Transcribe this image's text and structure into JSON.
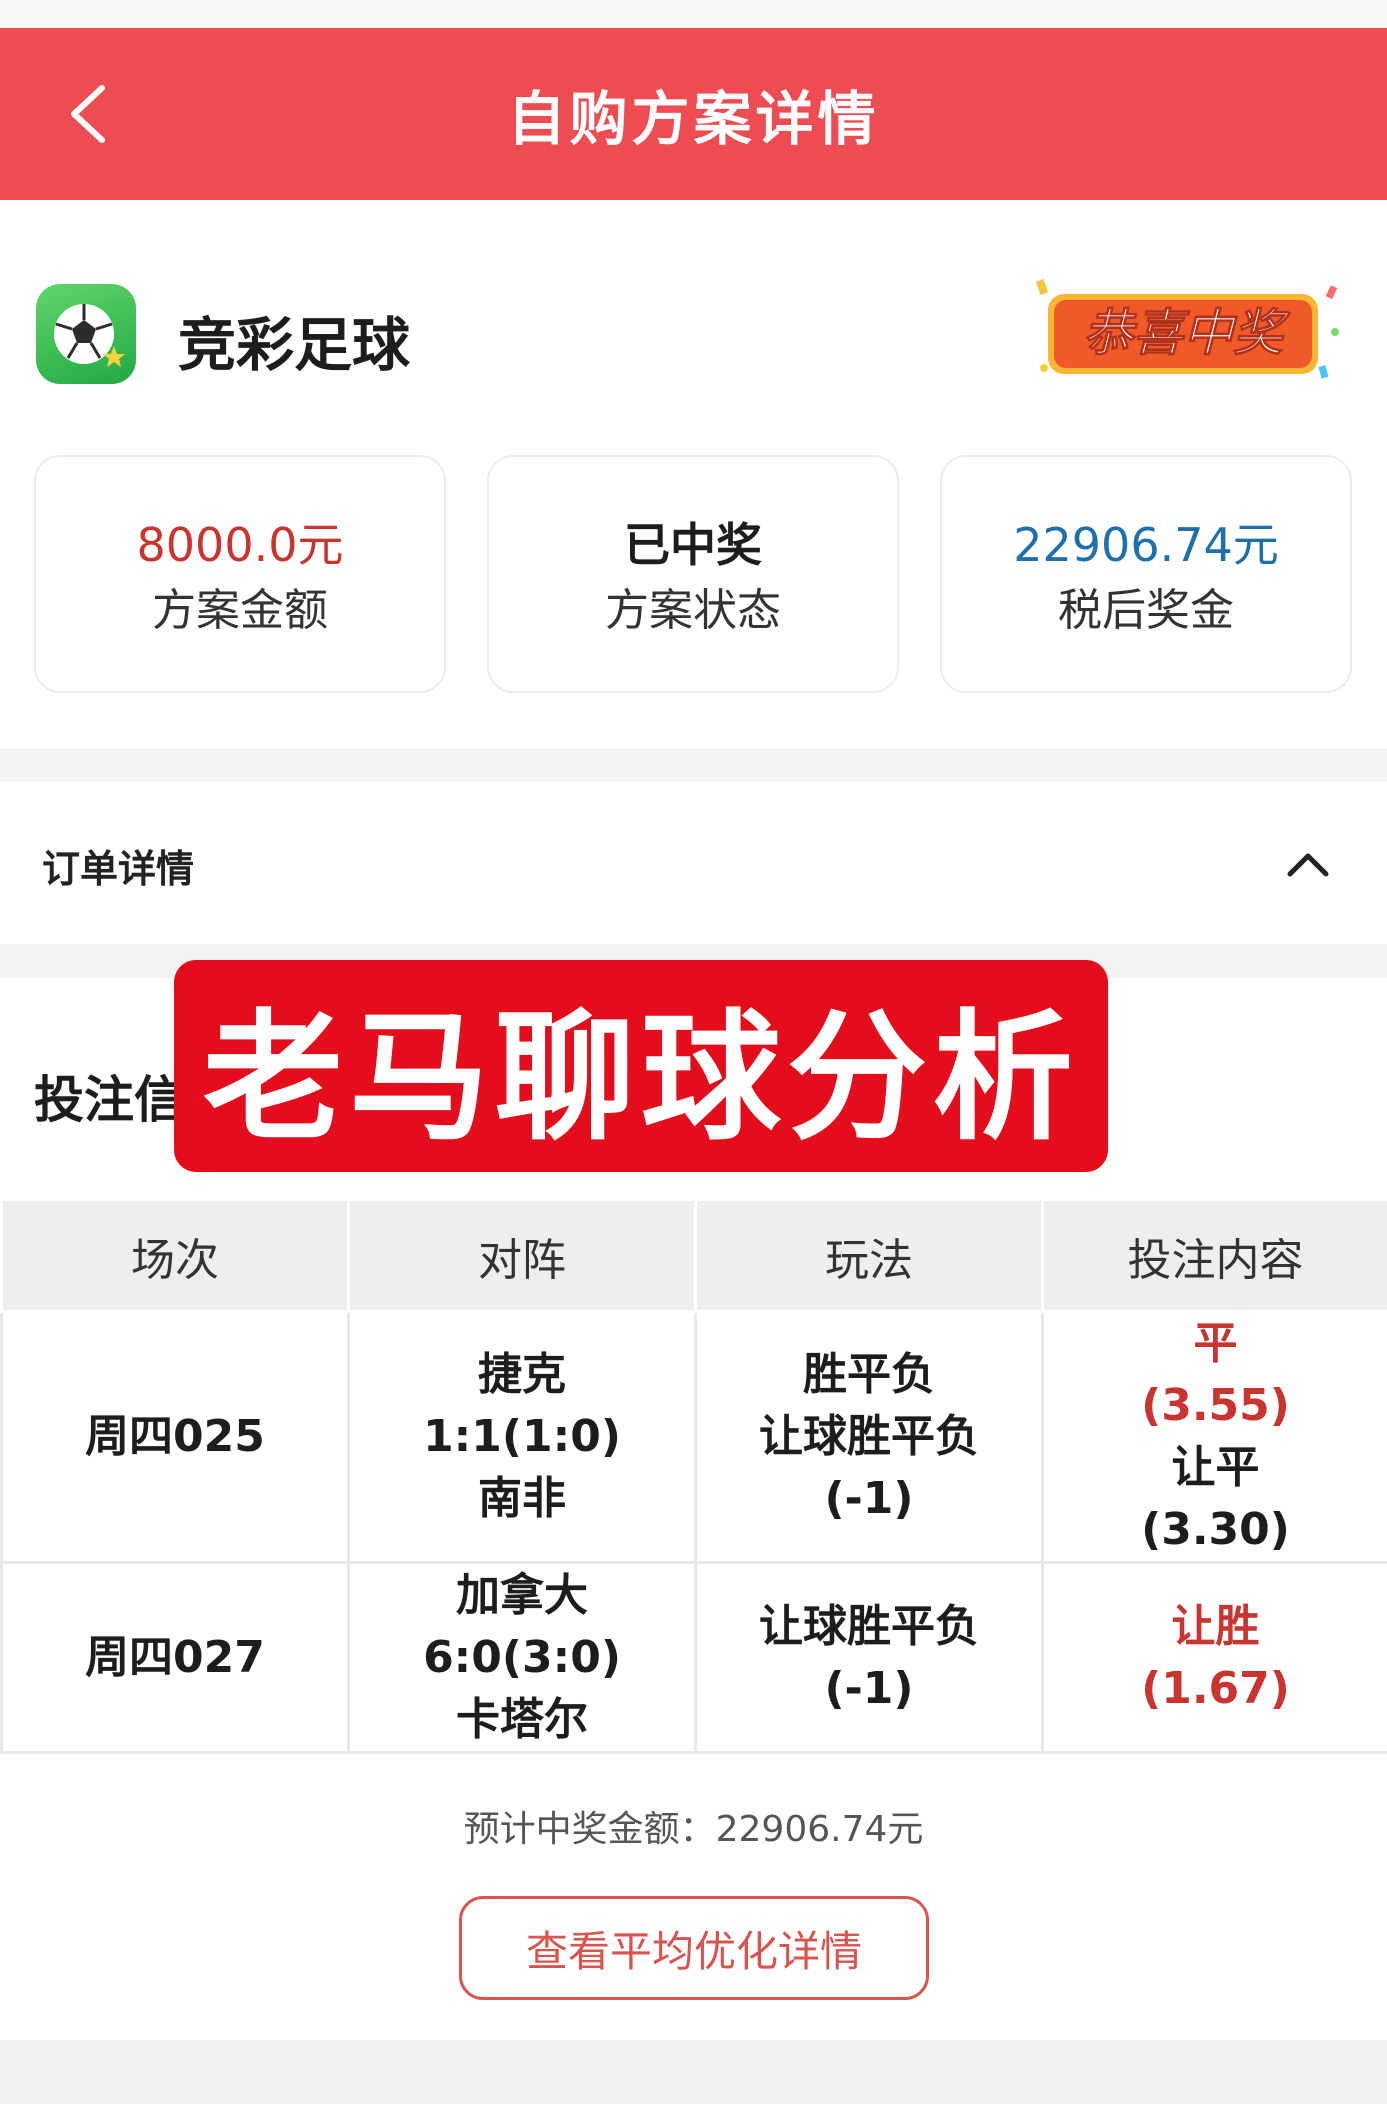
{
  "header": {
    "title": "自购方案详情",
    "back_icon": "chevron-left-icon",
    "bg_color": "#ee4c53"
  },
  "lottery": {
    "name": "竞彩足球",
    "icon": "soccer-ball-icon",
    "badge_text": "恭喜中奖"
  },
  "stats": [
    {
      "value": "8000.0元",
      "label": "方案金额",
      "color": "#c8342f"
    },
    {
      "value": "已中奖",
      "label": "方案状态",
      "color": "#1d1d1d"
    },
    {
      "value": "22906.74元",
      "label": "税后奖金",
      "color": "#1f6fa8"
    }
  ],
  "order": {
    "title": "订单详情",
    "toggle_icon": "chevron-up-icon"
  },
  "bet_info": {
    "title": "投注信息"
  },
  "watermark": {
    "text": "老马聊球分析"
  },
  "table": {
    "headers": [
      "场次",
      "对阵",
      "玩法",
      "投注内容"
    ],
    "rows": [
      {
        "session": "周四025",
        "home": "捷克",
        "score": "1:1(1:0)",
        "away": "南非",
        "play1": "胜平负",
        "play2": "让球胜平负",
        "play3": "(-1)",
        "bet1": "平",
        "odds1": "(3.55)",
        "bet2": "让平",
        "odds2": "(3.30)"
      },
      {
        "session": "周四027",
        "home": "加拿大",
        "score": "6:0(3:0)",
        "away": "卡塔尔",
        "play1": "让球胜平负",
        "play2": "(-1)",
        "bet1": "让胜",
        "odds1": "(1.67)"
      }
    ]
  },
  "footer": {
    "estimate": "预计中奖金额：22906.74元",
    "button_label": "查看平均优化详情"
  }
}
